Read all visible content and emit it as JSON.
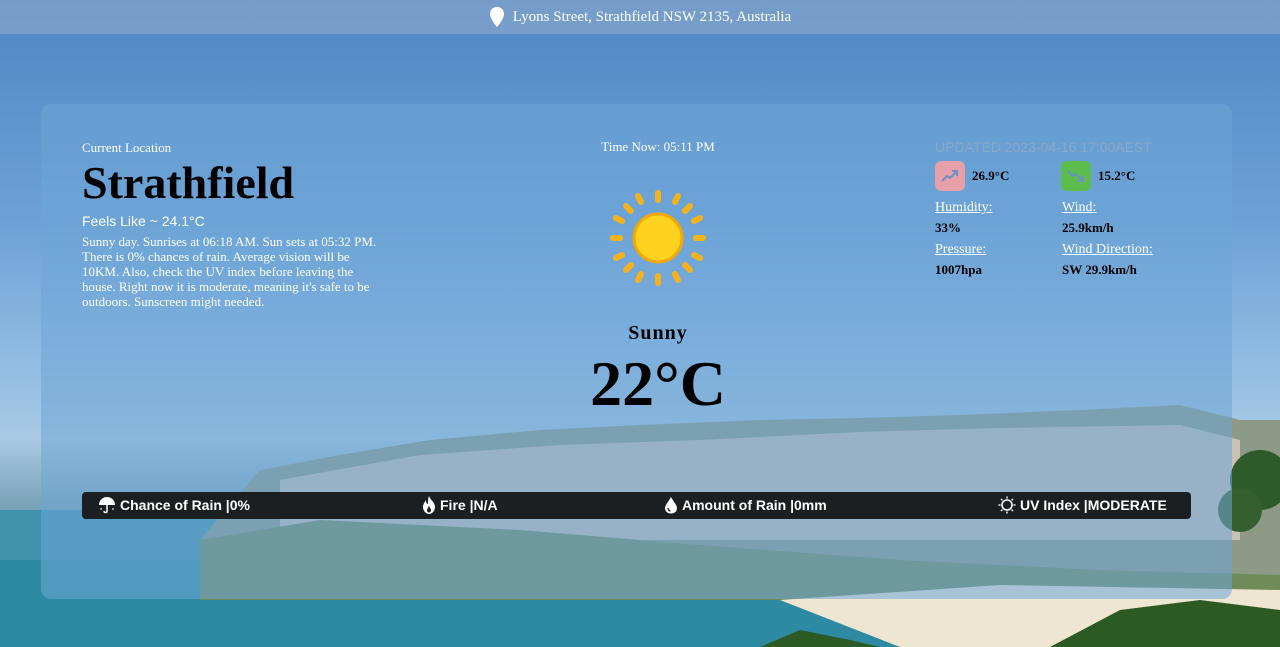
{
  "location_bar": {
    "address": "Lyons Street, Strathfield NSW 2135, Australia",
    "icon": "location-pin-icon"
  },
  "current": {
    "label": "Current Location",
    "city": "Strathfield",
    "feels_like": "Feels Like ~ 24.1°C",
    "description": "Sunny day. Sunrises at 06:18 AM. Sun sets at 05:32 PM. There is 0% chances of rain. Average vision will be 10KM. Also, check the UV index before leaving the house. Right now it is moderate, meaning it's safe to be outdoors. Sunscreen might needed."
  },
  "now": {
    "time": "Time Now: 05:11 PM",
    "icon": "sun-icon",
    "condition": "Sunny",
    "temperature": "22°C"
  },
  "details": {
    "updated": "UPDATED 2023-04-16 17:00AEST",
    "max_temp": "26.9°C",
    "min_temp": "15.2°C",
    "max_color": "#e8a0a8",
    "min_color": "#5cbc4c",
    "humidity_label": "Humidity:",
    "humidity": "33%",
    "wind_label": "Wind:",
    "wind": "25.9km/h",
    "pressure_label": "Pressure:",
    "pressure": "1007hpa",
    "wind_dir_label": "Wind Direction:",
    "wind_dir": "SW 29.9km/h"
  },
  "infobar": {
    "rain_chance": "Chance of Rain |0%",
    "fire": "Fire |N/A",
    "rain_amount": "Amount of Rain |0mm",
    "uv": "UV Index |MODERATE"
  }
}
